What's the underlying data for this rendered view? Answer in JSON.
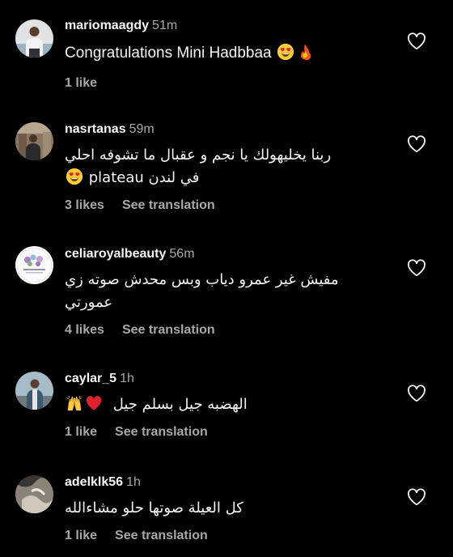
{
  "comments": [
    {
      "username": "mariomaagdy",
      "time": "51m",
      "text": "Congratulations Mini Hadbbaa",
      "likes": "1 like",
      "translation": ""
    },
    {
      "username": "nasrtanas",
      "time": "59m",
      "text_line1": "ربنا يخليهولك يا نجم و عقبال ما تشوفه احلي",
      "text_line2": "plateau في لندن",
      "likes": "3 likes",
      "translation": "See translation"
    },
    {
      "username": "celiaroyalbeauty",
      "time": "56m",
      "text_line1": "مفيش غير عمرو دياب وبس محدش صوته زي",
      "text_line2": "عمورتي",
      "likes": "4 likes",
      "translation": "See translation"
    },
    {
      "username": "caylar_5",
      "time": "1h",
      "text": "الهضبه جيل بسلم جيل",
      "likes": "1 like",
      "translation": "See translation"
    },
    {
      "username": "adelklk56",
      "time": "1h",
      "text": "كل العيلة صوتها حلو مشاءالله",
      "likes": "1 like",
      "translation": "See translation"
    }
  ],
  "icons": {
    "like": "heart-outline-icon",
    "heart_eyes": "smiling-face-with-heart-eyes-emoji",
    "fire": "fire-emoji",
    "red_heart": "red-heart-emoji",
    "raising_hands": "raising-hands-emoji"
  },
  "colors": {
    "background": "#000000",
    "primary_text": "#f5f5f5",
    "secondary_text": "#a8a8a8",
    "emoji_heart": "#e0202e",
    "emoji_yellow": "#ffcc33"
  }
}
